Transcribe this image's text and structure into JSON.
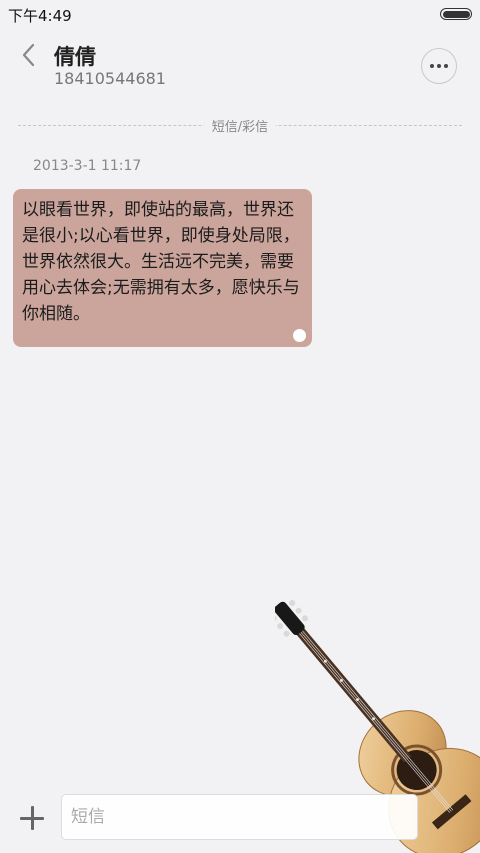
{
  "status_bar": {
    "time": "下午4:49",
    "battery_level": 1.0
  },
  "header": {
    "contact_name": "倩倩",
    "contact_number": "18410544681"
  },
  "thread": {
    "type_label": "短信/彩信",
    "messages": [
      {
        "timestamp": "2013-3-1 11:17",
        "text": "以眼看世界，即使站的最高，世界还是很小;以心看世界，即使身处局限，世界依然很大。生活远不完美，需要用心去体会;无需拥有太多，愿快乐与你相随。"
      }
    ]
  },
  "composer": {
    "placeholder": "短信",
    "value": ""
  },
  "icons": {
    "back": "chevron-left-icon",
    "more": "more-horizontal-icon",
    "add": "plus-icon",
    "decoration": "guitar-icon"
  },
  "colors": {
    "background": "#f2f2f4",
    "bubble": "#cba59c",
    "accent_text": "#777777"
  }
}
